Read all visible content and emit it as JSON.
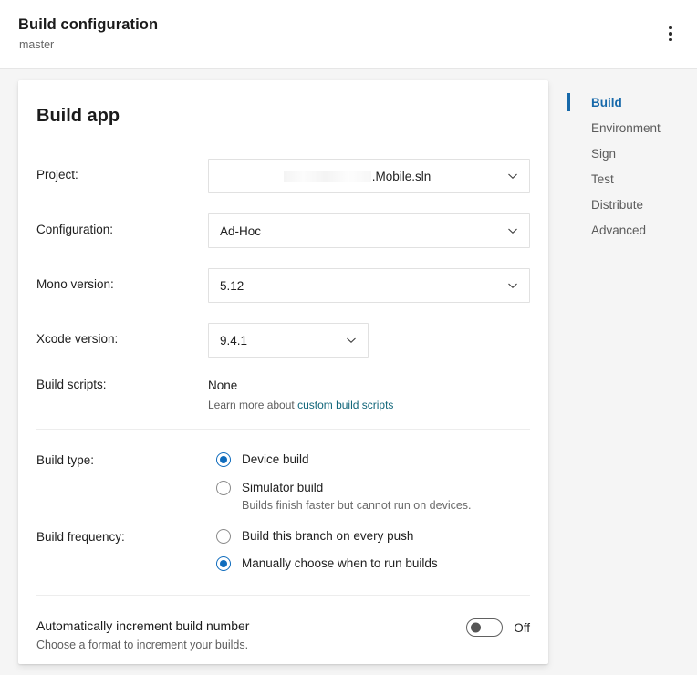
{
  "header": {
    "title": "Build configuration",
    "subtitle": "master",
    "menu_icon": "more-vertical-icon"
  },
  "card": {
    "title": "Build app",
    "fields": [
      {
        "label": "Project:",
        "value": ".Mobile.sln",
        "redacted_prefix": true,
        "control": "select",
        "width": "wide"
      },
      {
        "label": "Configuration:",
        "value": "Ad-Hoc",
        "control": "select",
        "width": "wide"
      },
      {
        "label": "Mono version:",
        "value": "5.12",
        "control": "select",
        "width": "wide"
      },
      {
        "label": "Xcode version:",
        "value": "9.4.1",
        "control": "select",
        "width": "narrow"
      }
    ],
    "build_scripts": {
      "label": "Build scripts:",
      "value": "None",
      "hint_prefix": "Learn more about ",
      "hint_link": "custom build scripts"
    },
    "build_type": {
      "label": "Build type:",
      "options": [
        {
          "label": "Device build",
          "sub": "",
          "checked": true
        },
        {
          "label": "Simulator build",
          "sub": "Builds finish faster but cannot run on devices.",
          "checked": false
        }
      ]
    },
    "build_frequency": {
      "label": "Build frequency:",
      "options": [
        {
          "label": "Build this branch on every push",
          "checked": false
        },
        {
          "label": "Manually choose when to run builds",
          "checked": true
        }
      ]
    },
    "auto_increment": {
      "title": "Automatically increment build number",
      "subtitle": "Choose a format to increment your builds.",
      "state": "Off",
      "enabled": false
    }
  },
  "sidenav": {
    "items": [
      {
        "label": "Build",
        "active": true
      },
      {
        "label": "Environment",
        "active": false
      },
      {
        "label": "Sign",
        "active": false
      },
      {
        "label": "Test",
        "active": false
      },
      {
        "label": "Distribute",
        "active": false
      },
      {
        "label": "Advanced",
        "active": false
      }
    ]
  },
  "colors": {
    "accent": "#0f6cbd",
    "nav_active": "#1769aa",
    "link": "#11667a",
    "page_bg": "#f5f5f5",
    "card_bg": "#ffffff"
  }
}
